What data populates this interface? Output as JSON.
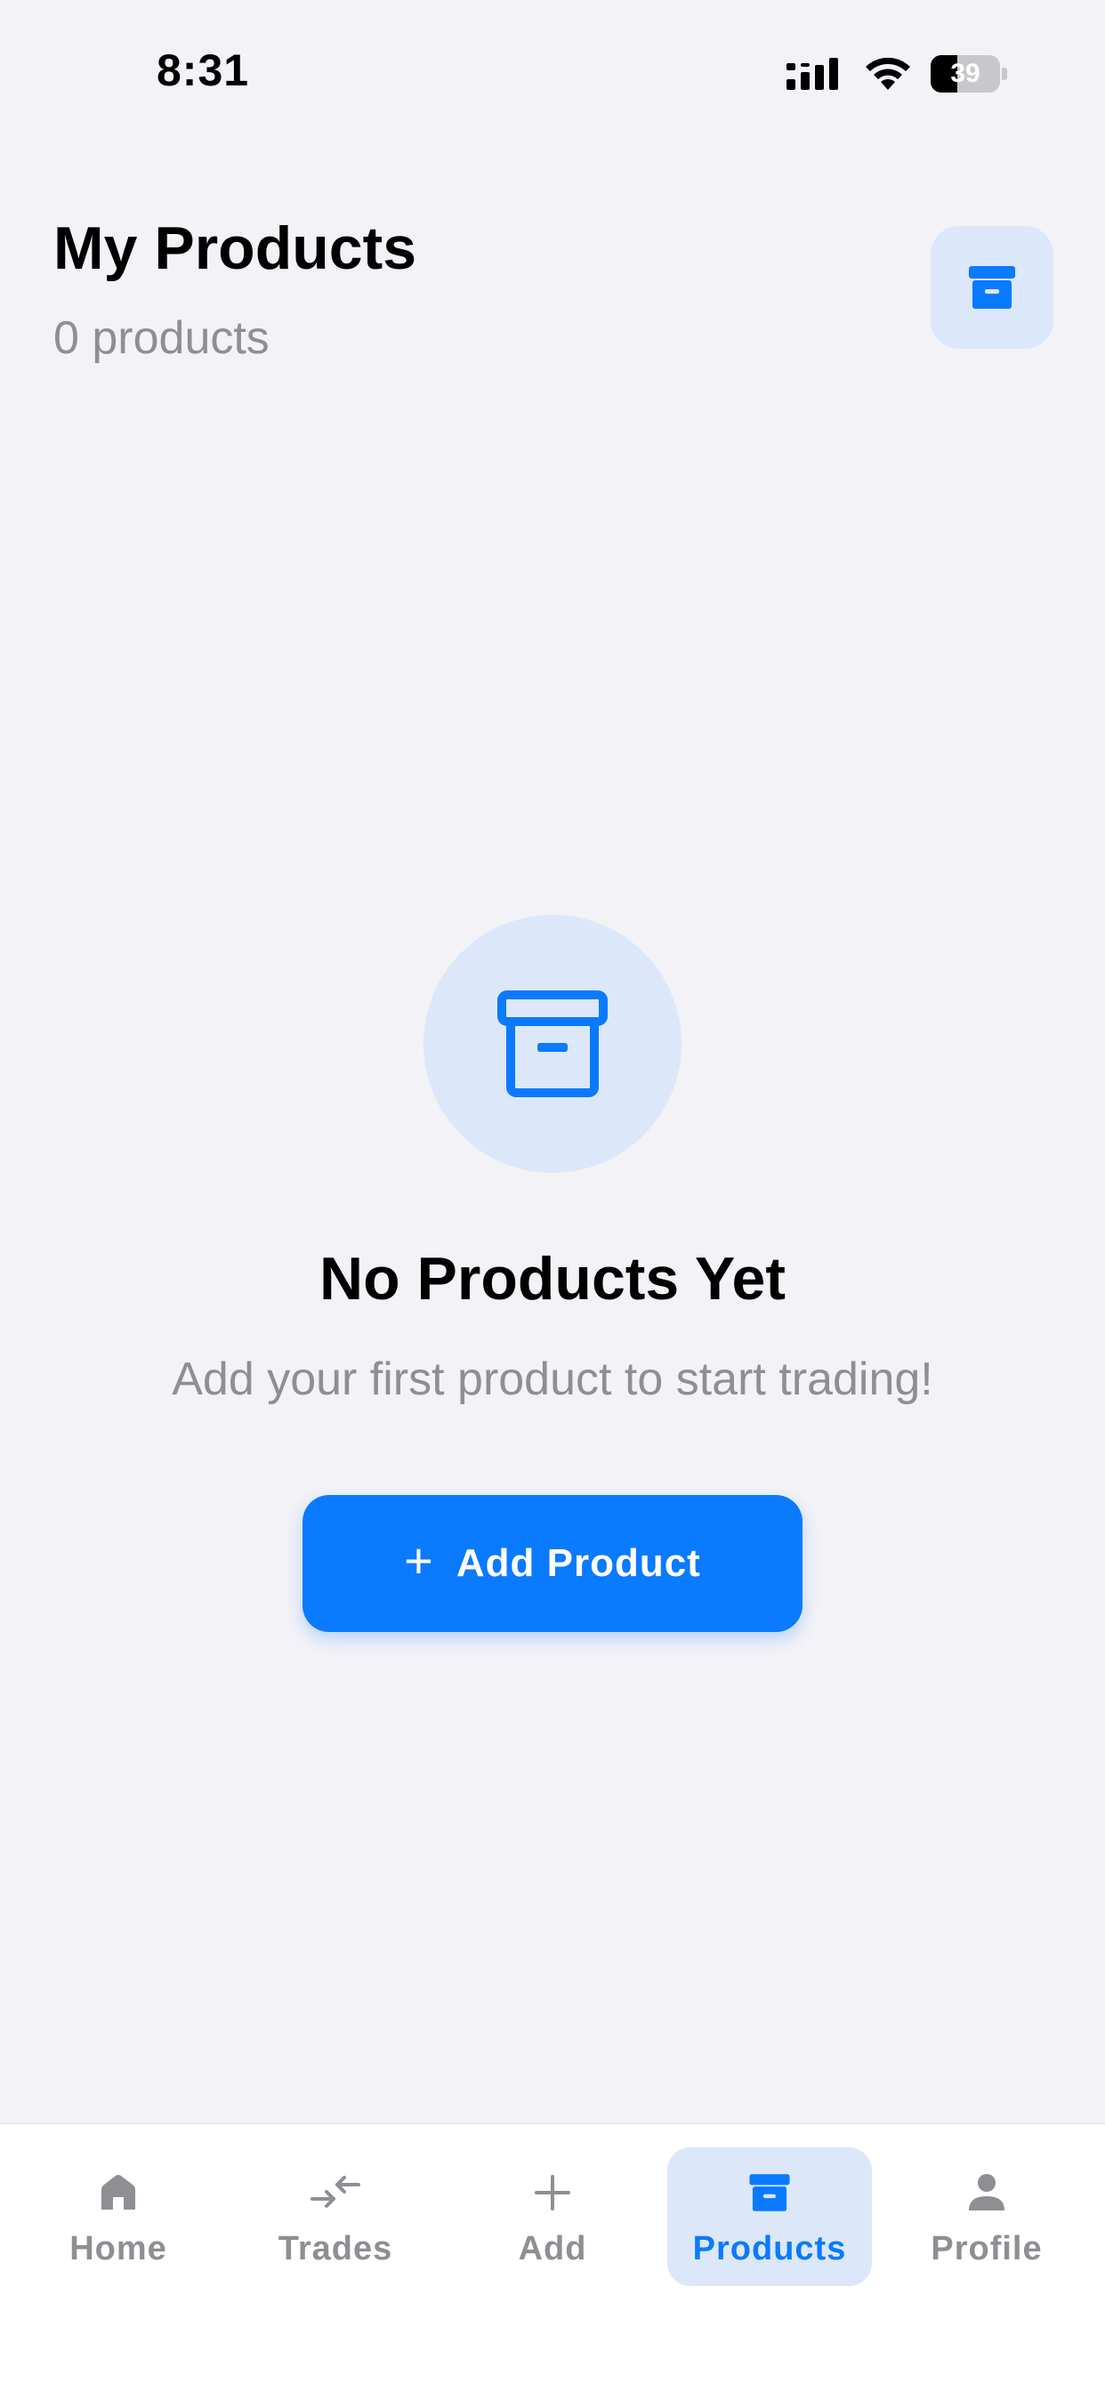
{
  "status_bar": {
    "time": "8:31",
    "battery_level": "39",
    "icons": [
      "signal-icon",
      "wifi-icon",
      "battery-icon"
    ]
  },
  "header": {
    "title": "My Products",
    "count_text": "0 products",
    "action_icon": "archive-box-icon"
  },
  "empty_state": {
    "icon": "archive-box-icon",
    "title": "No Products Yet",
    "subtitle": "Add your first product to start trading!",
    "button_icon": "+",
    "button_label": "Add Product"
  },
  "tab_bar": {
    "active": "Products",
    "items": [
      {
        "label": "Home",
        "icon": "home-icon"
      },
      {
        "label": "Trades",
        "icon": "swap-arrows-icon"
      },
      {
        "label": "Add",
        "icon": "plus-icon"
      },
      {
        "label": "Products",
        "icon": "archive-box-icon"
      },
      {
        "label": "Profile",
        "icon": "person-icon"
      }
    ]
  },
  "colors": {
    "accent": "#0A7AFF",
    "accent_light": "#DCE8F9",
    "background": "#F2F2F7",
    "secondary_text": "#8E8E93"
  }
}
